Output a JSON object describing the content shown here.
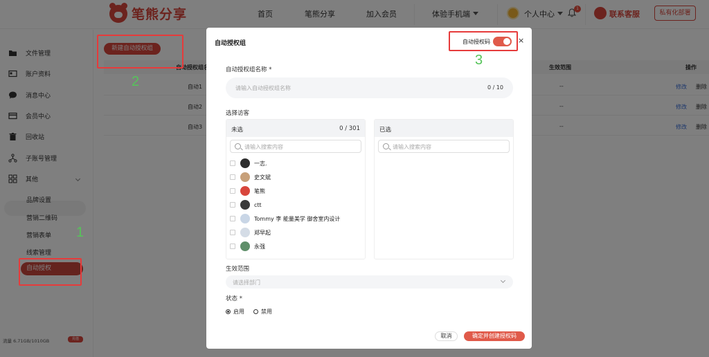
{
  "header": {
    "logo_text": "笔熊分享",
    "nav": [
      "首页",
      "笔熊分享",
      "加入会员",
      "体验手机端"
    ],
    "user_center": "个人中心",
    "notification_count": "1",
    "customer_service": "联系客服",
    "private_deploy": "私有化部署"
  },
  "sidebar": {
    "items": [
      "文件管理",
      "账户资料",
      "消息中心",
      "会员中心",
      "回收站",
      "子账号管理",
      "其他"
    ],
    "sub_items": [
      "品牌设置",
      "营销二维码",
      "营销表单",
      "线索管理",
      "自动授权"
    ],
    "storage_label": "流量 6.71GB/1010GB",
    "storage_button": "充值"
  },
  "main": {
    "new_button": "新建自动授权组",
    "columns": [
      "自动授权组名",
      "生效范围",
      "操作"
    ],
    "rows": [
      {
        "name": "自动1",
        "scope": "--",
        "edit": "修改",
        "delete": "删除"
      },
      {
        "name": "自动2",
        "scope": "--",
        "edit": "修改",
        "delete": "删除"
      },
      {
        "name": "自动3",
        "scope": "--",
        "edit": "修改",
        "delete": "删除"
      }
    ]
  },
  "annotations": [
    "1",
    "2",
    "3"
  ],
  "modal": {
    "title": "自动授权组",
    "auth_code_label": "自动授权码",
    "close": "×",
    "name_label": "自动授权组名称",
    "required_mark": "*",
    "name_placeholder": "请输入自动授权组名称",
    "name_count": "0 / 10",
    "visitors_label": "选择访客",
    "unselected_title": "未选",
    "unselected_count": "0 / 301",
    "selected_title": "已选",
    "search_placeholder": "请输入搜索内容",
    "visitors": [
      {
        "name": "一志.",
        "color": "#2d2d2d"
      },
      {
        "name": "史文斌",
        "color": "#c7a07a"
      },
      {
        "name": "笔熊",
        "color": "#d8463c"
      },
      {
        "name": "ctt",
        "color": "#3b3b3b"
      },
      {
        "name": "Tommy 李 能量美学 御舍室内设计",
        "color": "#c9d6e6"
      },
      {
        "name": "郑早起",
        "color": "#d4dce6"
      },
      {
        "name": "永强",
        "color": "#5f8f6a"
      }
    ],
    "scope_label": "生效范围",
    "scope_placeholder": "请选择部门",
    "status_label": "状态",
    "status_enabled": "启用",
    "status_disabled": "禁用",
    "cancel": "取消",
    "confirm": "确定并创建授权码"
  }
}
